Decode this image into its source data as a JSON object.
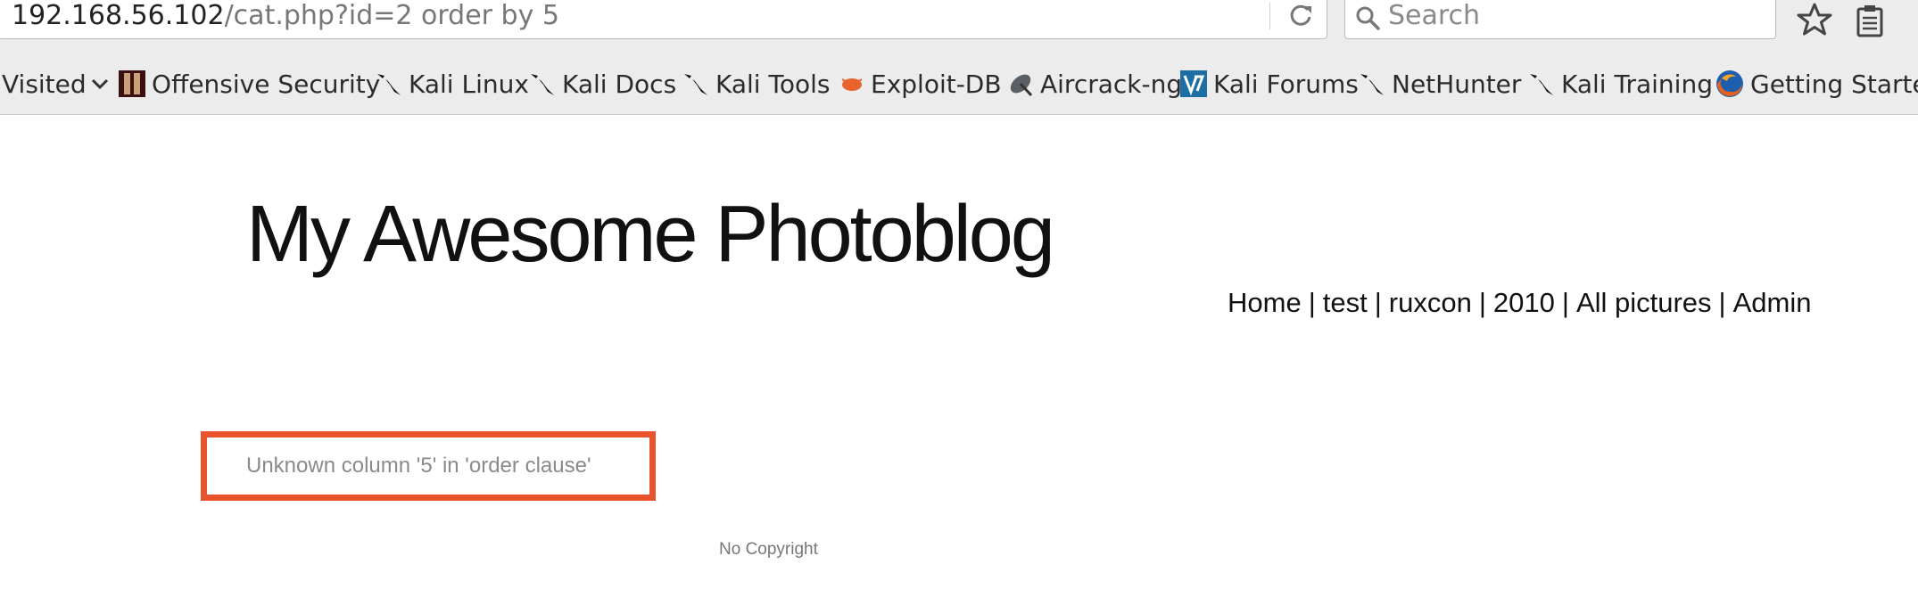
{
  "browser": {
    "url_host": "192.168.56.102",
    "url_path": "/cat.php?id=2 order by 5",
    "search_placeholder": "Search"
  },
  "bookmarks": [
    {
      "label": "Visited",
      "icon": "chevron-down-icon"
    },
    {
      "label": "Offensive Security",
      "icon": "offensive-security-logo-icon"
    },
    {
      "label": "Kali Linux",
      "icon": "kali-dragon-icon"
    },
    {
      "label": "Kali Docs",
      "icon": "kali-dragon-icon"
    },
    {
      "label": "Kali Tools",
      "icon": "kali-dragon-icon"
    },
    {
      "label": "Exploit-DB",
      "icon": "exploit-db-bug-icon"
    },
    {
      "label": "Aircrack-ng",
      "icon": "aircrack-antenna-icon"
    },
    {
      "label": "Kali Forums",
      "icon": "kali-forums-icon"
    },
    {
      "label": "NetHunter",
      "icon": "kali-dragon-icon"
    },
    {
      "label": "Kali Training",
      "icon": "kali-dragon-icon"
    },
    {
      "label": "Getting Started",
      "icon": "firefox-icon"
    }
  ],
  "page": {
    "title": "My Awesome Photoblog",
    "nav": [
      "Home",
      "test",
      "ruxcon",
      "2010",
      "All pictures",
      "Admin"
    ],
    "nav_separator": "|",
    "error_message": "Unknown column '5' in 'order clause'",
    "footer": "No Copyright"
  },
  "colors": {
    "highlight_border": "#e8532c",
    "toolbar_bg": "#ececec"
  }
}
